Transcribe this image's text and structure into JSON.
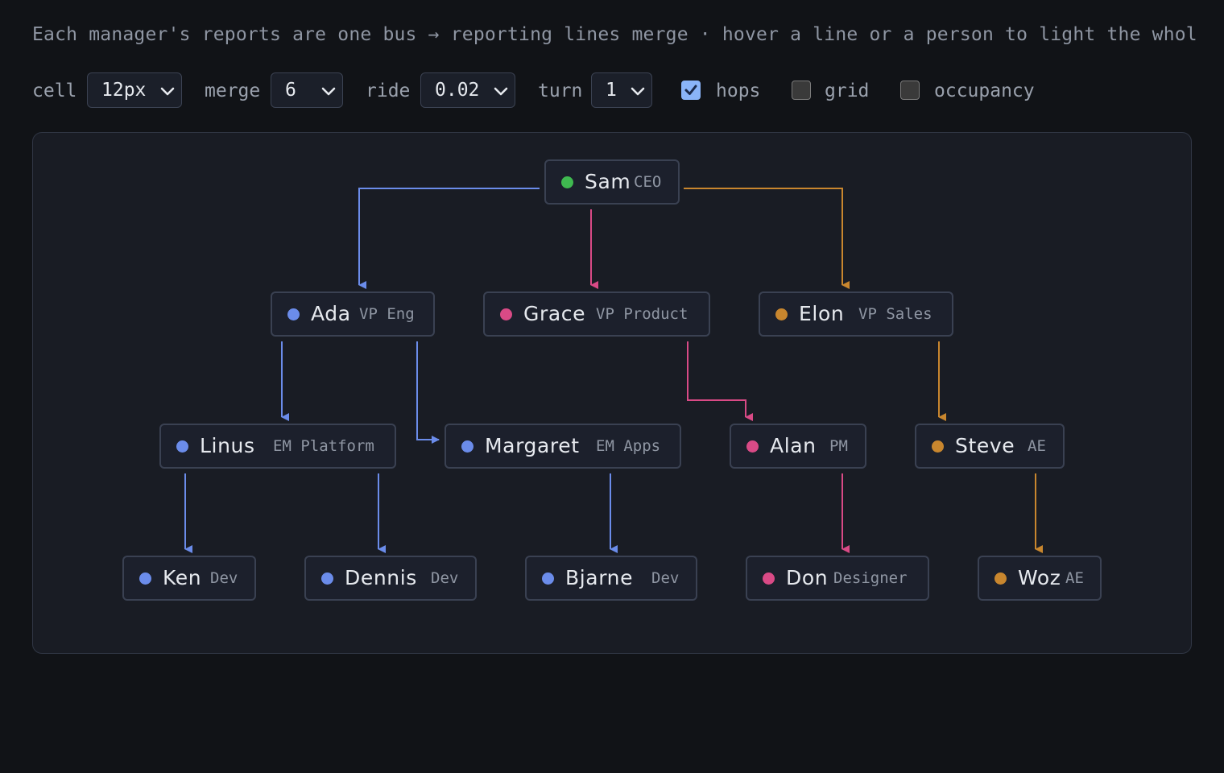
{
  "hint": "Each manager's reports are one bus → reporting lines merge · hover a line or a person to light the whol",
  "controls": {
    "cell": {
      "label": "cell",
      "value": "12px"
    },
    "merge": {
      "label": "merge",
      "value": "6"
    },
    "ride": {
      "label": "ride",
      "value": "0.02"
    },
    "turn": {
      "label": "turn",
      "value": "1"
    },
    "hops": {
      "label": "hops",
      "checked": true
    },
    "grid": {
      "label": "grid",
      "checked": false
    },
    "occupancy": {
      "label": "occupancy",
      "checked": false
    }
  },
  "colors": {
    "green": "#3fb950",
    "blue": "#6b8cea",
    "pink": "#d94a86",
    "orange": "#c8862e"
  },
  "org": [
    {
      "id": "sam",
      "name": "Sam",
      "role": "CEO",
      "color": "green"
    },
    {
      "id": "ada",
      "name": "Ada",
      "role": "VP Eng",
      "color": "blue",
      "manager": "sam"
    },
    {
      "id": "grace",
      "name": "Grace",
      "role": "VP Product",
      "color": "pink",
      "manager": "sam"
    },
    {
      "id": "elon",
      "name": "Elon",
      "role": "VP Sales",
      "color": "orange",
      "manager": "sam"
    },
    {
      "id": "linus",
      "name": "Linus",
      "role": "EM Platform",
      "color": "blue",
      "manager": "ada"
    },
    {
      "id": "margaret",
      "name": "Margaret",
      "role": "EM Apps",
      "color": "blue",
      "manager": "ada"
    },
    {
      "id": "alan",
      "name": "Alan",
      "role": "PM",
      "color": "pink",
      "manager": "grace"
    },
    {
      "id": "steve",
      "name": "Steve",
      "role": "AE",
      "color": "orange",
      "manager": "elon"
    },
    {
      "id": "ken",
      "name": "Ken",
      "role": "Dev",
      "color": "blue",
      "manager": "linus"
    },
    {
      "id": "dennis",
      "name": "Dennis",
      "role": "Dev",
      "color": "blue",
      "manager": "linus"
    },
    {
      "id": "bjarne",
      "name": "Bjarne",
      "role": "Dev",
      "color": "blue",
      "manager": "margaret"
    },
    {
      "id": "don",
      "name": "Don",
      "role": "Designer",
      "color": "pink",
      "manager": "alan"
    },
    {
      "id": "woz",
      "name": "Woz",
      "role": "AE",
      "color": "orange",
      "manager": "steve"
    }
  ]
}
